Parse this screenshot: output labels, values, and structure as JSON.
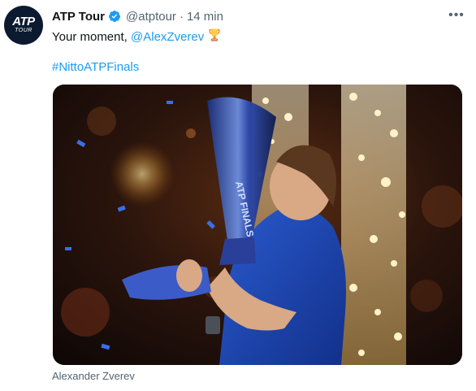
{
  "tweet": {
    "author_name": "ATP Tour",
    "handle": "@atptour",
    "separator": "·",
    "time": "14 min",
    "text_prefix": "Your moment, ",
    "mention": "@AlexZverev",
    "hashtag": "#NittoATPFinals",
    "media_caption": "Alexander Zverev"
  },
  "avatar": {
    "logo_main": "ATP",
    "logo_sub": "TOUR"
  },
  "trophy_text": "ATP FINALS",
  "icons": {
    "verified": "verified-badge-icon",
    "more": "more-options-icon",
    "trophy": "trophy-emoji-icon"
  },
  "colors": {
    "link": "#1d9bf0",
    "verified": "#1d9bf0",
    "secondary_text": "#536471"
  }
}
